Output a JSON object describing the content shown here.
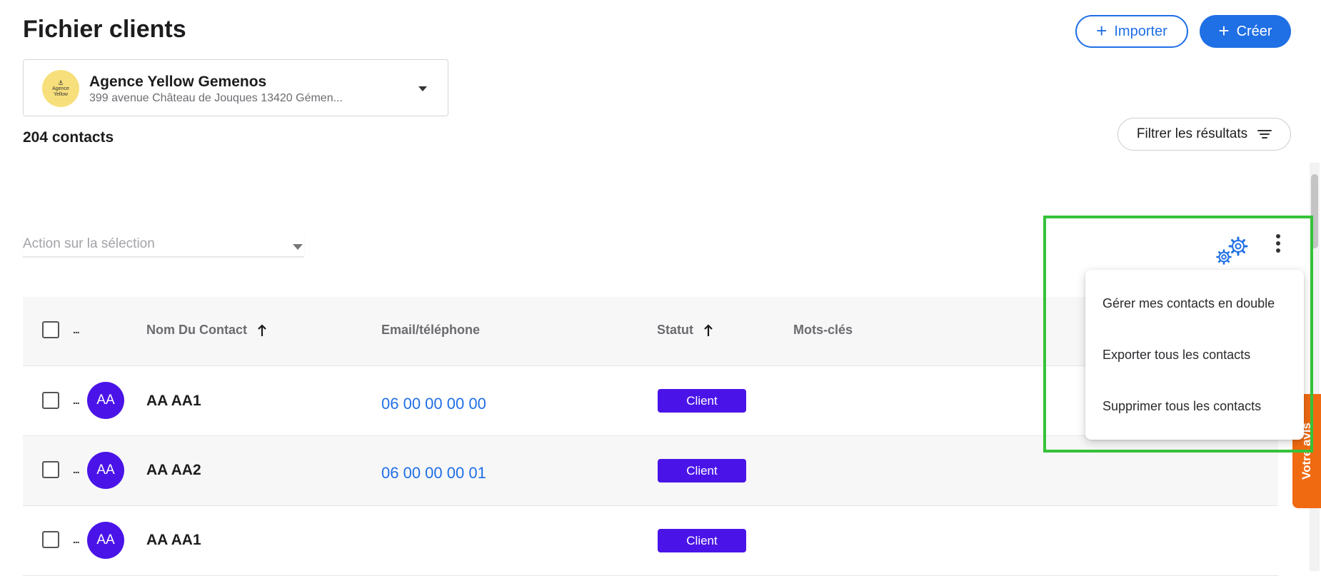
{
  "header": {
    "title": "Fichier clients",
    "import_label": "Importer",
    "create_label": "Créer"
  },
  "agency": {
    "logo_text_line1": "Agence",
    "logo_text_line2": "Yellow",
    "name": "Agence Yellow Gemenos",
    "address": "399 avenue Château de Jouques 13420 Gémen..."
  },
  "contacts_count": "204 contacts",
  "filter_label": "Filtrer les résultats",
  "action_select": {
    "placeholder": "Action sur la sélection"
  },
  "table": {
    "columns": {
      "more": "...",
      "name": "Nom Du Contact",
      "email_phone": "Email/téléphone",
      "status": "Statut",
      "keywords": "Mots-clés"
    },
    "rows": [
      {
        "initials": "AA",
        "name": "AA AA1",
        "phone": "06 00 00 00 00",
        "status": "Client"
      },
      {
        "initials": "AA",
        "name": "AA AA2",
        "phone": "06 00 00 00 01",
        "status": "Client"
      },
      {
        "initials": "AA",
        "name": "AA AA1",
        "phone": "",
        "status": "Client"
      }
    ]
  },
  "menu": {
    "items": [
      "Gérer mes contacts en double",
      "Exporter tous les contacts",
      "Supprimer tous les contacts"
    ]
  },
  "feedback": {
    "label": "Votre avis"
  },
  "colors": {
    "accent": "#1f6fe5",
    "badge": "#4a14e8",
    "highlight": "#35c23a",
    "feedback": "#f06a12"
  }
}
